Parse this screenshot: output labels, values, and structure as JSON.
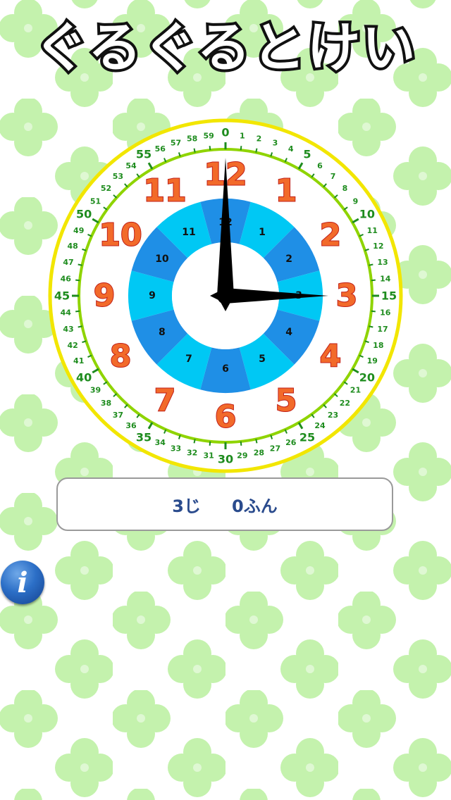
{
  "app": {
    "title": "ぐるぐるとけい"
  },
  "clock": {
    "hour": 3,
    "minute": 0,
    "hour_numerals": [
      "12",
      "1",
      "2",
      "3",
      "4",
      "5",
      "6",
      "7",
      "8",
      "9",
      "10",
      "11"
    ],
    "inner_hour_numbers": [
      "12",
      "1",
      "2",
      "3",
      "4",
      "5",
      "6",
      "7",
      "8",
      "9",
      "10",
      "11"
    ],
    "minute_labels": [
      "0",
      "1",
      "2",
      "3",
      "4",
      "5",
      "6",
      "7",
      "8",
      "9",
      "10",
      "11",
      "12",
      "13",
      "14",
      "15",
      "16",
      "17",
      "18",
      "19",
      "20",
      "21",
      "22",
      "23",
      "24",
      "25",
      "26",
      "27",
      "28",
      "29",
      "30",
      "31",
      "32",
      "33",
      "34",
      "35",
      "36",
      "37",
      "38",
      "39",
      "40",
      "41",
      "42",
      "43",
      "44",
      "45",
      "46",
      "47",
      "48",
      "49",
      "50",
      "51",
      "52",
      "53",
      "54",
      "55",
      "56",
      "57",
      "58",
      "59"
    ],
    "colors": {
      "outer_ring": "#f2e600",
      "minute_ring": "#8fd400",
      "minute_text": "#1e8c1e",
      "numeral_fill": "#f26a2a",
      "numeral_stroke": "#c0201a",
      "inner_dark": "#1f8fe6",
      "inner_light": "#00c8f4",
      "hands": "#000000"
    }
  },
  "time_display": {
    "hour_text": "3じ",
    "minute_text": "0ふん"
  },
  "info_button": {
    "icon": "info-icon",
    "glyph": "i"
  },
  "background": {
    "pattern": "clover",
    "color": "#b8f0a0"
  }
}
